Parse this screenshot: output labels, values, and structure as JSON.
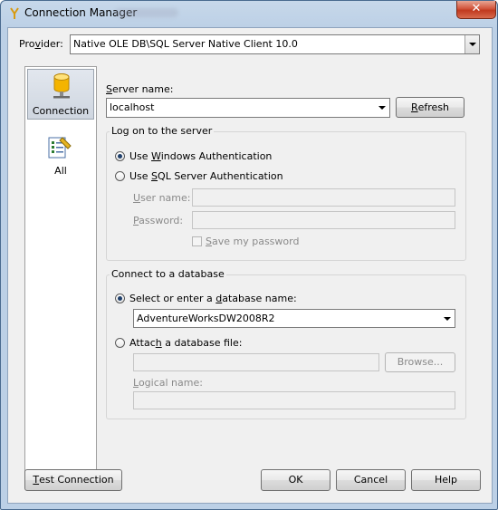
{
  "window": {
    "title": "Connection Manager",
    "close_symbol": "✕"
  },
  "provider": {
    "label_pre": "Pro",
    "label_key": "v",
    "label_post": "ider:",
    "value": "Native OLE DB\\SQL Server Native Client 10.0"
  },
  "sidebar": {
    "items": [
      {
        "label": "Connection",
        "icon": "database-cylinder-icon",
        "selected": true
      },
      {
        "label": "All",
        "icon": "properties-list-icon",
        "selected": false
      }
    ]
  },
  "server": {
    "label_key": "S",
    "label_post": "erver name:",
    "value": "localhost",
    "refresh_key": "R",
    "refresh_post": "efresh"
  },
  "logon": {
    "group_title": "Log on to the server",
    "windows_auth": {
      "pre": "Use ",
      "key": "W",
      "post": "indows Authentication",
      "selected": true
    },
    "sql_auth": {
      "pre": "Use ",
      "key": "S",
      "post": "QL Server Authentication",
      "selected": false
    },
    "username_label": {
      "key": "U",
      "post": "ser name:"
    },
    "password_label": {
      "key": "P",
      "post": "assword:"
    },
    "save_password": {
      "key": "S",
      "post": "ave my password"
    }
  },
  "database": {
    "group_title": "Connect to a database",
    "select_option": {
      "pre": "Select or enter a ",
      "key": "d",
      "post": "atabase name:",
      "selected": true
    },
    "db_name": "AdventureWorksDW2008R2",
    "attach_option": {
      "pre": "Attac",
      "key": "h",
      "post": " a database file:",
      "selected": false
    },
    "browse_label": "Browse...",
    "logical_label": {
      "key": "L",
      "post": "ogical name:"
    }
  },
  "footer": {
    "test_key": "T",
    "test_post": "est Connection",
    "ok": "OK",
    "cancel": "Cancel",
    "help": "Help"
  },
  "colors": {
    "title_gradient_top": "#c7d8ea",
    "close_red": "#c0391e",
    "dialog_bg": "#f0f0f0",
    "radio_dot": "#1f3f6b"
  }
}
